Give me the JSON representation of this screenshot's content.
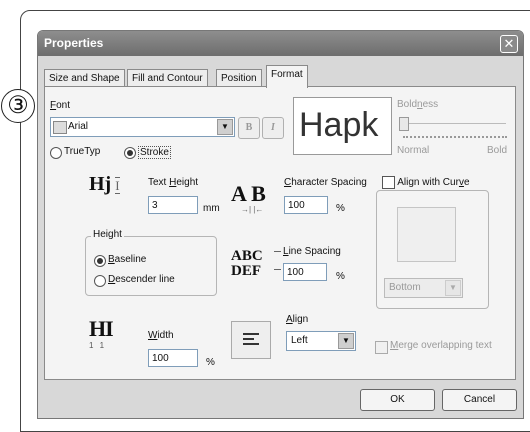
{
  "step_badge": "③",
  "dialog": {
    "title": "Properties",
    "close_glyph": "✕",
    "tabs": [
      "Size and Shape",
      "Fill and Contour",
      "Position",
      "Format"
    ],
    "active_tab": "Format"
  },
  "font": {
    "label_ul": "F",
    "label_rest": "ont",
    "selected": "Arial",
    "bold_btn": "B",
    "italic_btn": "I",
    "preview_text": "Hapk",
    "option_truetype": "TrueTyp",
    "option_stroke": "Stroke",
    "selected_option": "Stroke"
  },
  "boldness": {
    "label_pre": "Bold",
    "label_ul": "n",
    "label_post": "ess",
    "min_label": "Normal",
    "max_label": "Bold",
    "level": 0.0
  },
  "text_height": {
    "icon_text": "Hj",
    "label_pre": "Text ",
    "label_ul": "H",
    "label_post": "eight",
    "value": "3",
    "unit": "mm"
  },
  "height_group": {
    "title": "Height",
    "baseline_ul": "B",
    "baseline_rest": "aseline",
    "descender_ul": "D",
    "descender_rest": "escender line",
    "selected": "Baseline"
  },
  "width": {
    "icon_text": "HI",
    "icon_sub": "1 1",
    "label_ul": "W",
    "label_rest": "idth",
    "value": "100",
    "unit": "%"
  },
  "character_spacing": {
    "icon_text": "A B",
    "label_ul": "C",
    "label_rest": "haracter Spacing",
    "value": "100",
    "unit": "%"
  },
  "line_spacing": {
    "icon_line1": "ABC",
    "icon_line2": "DEF",
    "label_ul": "L",
    "label_rest": "ine Spacing",
    "value": "100",
    "unit": "%"
  },
  "align": {
    "label_ul": "A",
    "label_rest": "lign",
    "value": "Left"
  },
  "align_with_curve": {
    "label_pre": "Align with Cur",
    "label_ul": "v",
    "label_post": "e",
    "checked": false,
    "dropdown_value": "Bottom"
  },
  "merge": {
    "label_ul": "M",
    "label_rest": "erge overlapping text",
    "checked": false
  },
  "buttons": {
    "ok": "OK",
    "cancel": "Cancel"
  }
}
